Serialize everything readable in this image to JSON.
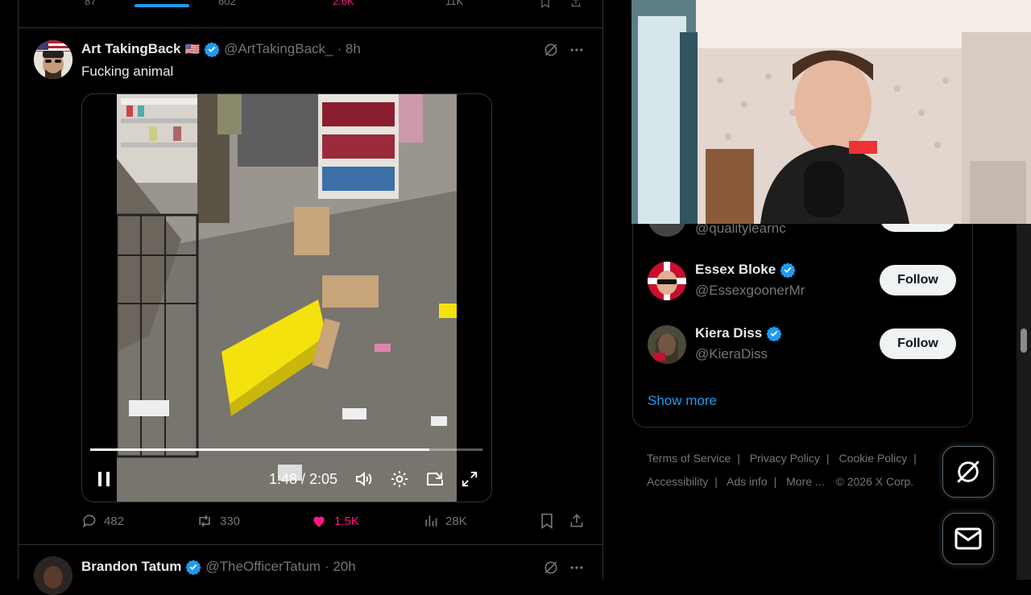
{
  "feed": {
    "previous_tweet": {
      "replies": "87",
      "reposts": "602",
      "likes": "2.6K",
      "views": "11K"
    },
    "tweet1": {
      "name": "Art TakingBack",
      "flag": "🇺🇸",
      "handle": "@ArtTakingBack_",
      "time": "· 8h",
      "text": "Fucking animal",
      "video": {
        "time_label": "1:48 / 2:05",
        "progress_fraction": 0.865
      },
      "replies": "482",
      "reposts": "330",
      "likes": "1.5K",
      "views": "28K",
      "like_color": "#f91880"
    },
    "tweet2": {
      "name": "Brandon Tatum",
      "handle": "@TheOfficerTatum",
      "time": "· 20h"
    }
  },
  "who_to_follow": {
    "partial_handle": "@qualitylearnc",
    "items": [
      {
        "name": "Essex Bloke",
        "handle": "@EssexgoonerMr",
        "button": "Follow"
      },
      {
        "name": "Kiera Diss",
        "handle": "@KieraDiss",
        "button": "Follow"
      }
    ],
    "show_more": "Show more"
  },
  "footer": {
    "links": [
      "Terms of Service",
      "Privacy Policy",
      "Cookie Policy",
      "Accessibility",
      "Ads info",
      "More ..."
    ],
    "copyright": "© 2026 X Corp."
  },
  "colors": {
    "accent": "#1d9bf0",
    "verified": "#1d9bf0",
    "like": "#f91880",
    "background": "#000000"
  },
  "icons": [
    "grok-icon",
    "more-icon",
    "reply-icon",
    "repost-icon",
    "heart-icon",
    "views-icon",
    "bookmark-icon",
    "share-icon",
    "pause-icon",
    "volume-icon",
    "settings-icon",
    "pip-icon",
    "fullscreen-icon",
    "messages-icon"
  ]
}
